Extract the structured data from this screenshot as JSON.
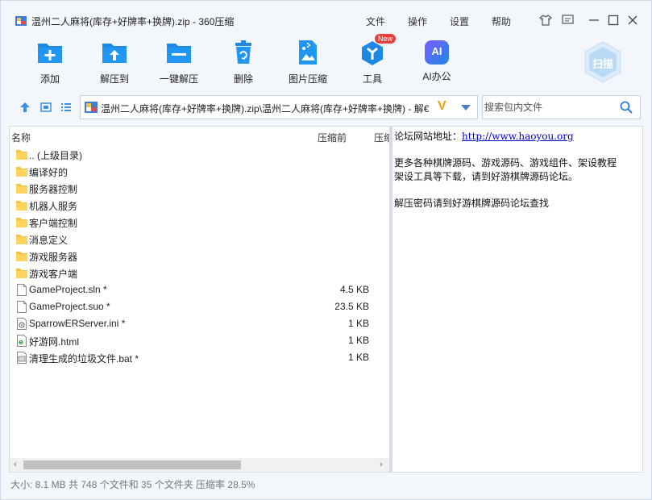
{
  "window": {
    "title": "温州二人麻将(库存+好牌率+换牌).zip - 360压缩",
    "menu": [
      "文件",
      "操作",
      "设置",
      "帮助"
    ]
  },
  "toolbar": {
    "items": [
      {
        "label": "添加",
        "icon": "add-icon"
      },
      {
        "label": "解压到",
        "icon": "extract-to-icon"
      },
      {
        "label": "一键解压",
        "icon": "one-click-extract-icon"
      },
      {
        "label": "删除",
        "icon": "delete-icon"
      },
      {
        "label": "图片压缩",
        "icon": "image-compress-icon"
      },
      {
        "label": "工具",
        "icon": "tools-icon",
        "badge": "New"
      },
      {
        "label": "AI办公",
        "icon": "ai-office-icon",
        "icon_text": "AI"
      }
    ],
    "scan_label": "扫描"
  },
  "address": {
    "path": "温州二人麻将(库存+好牌率+换牌).zip\\温州二人麻将(库存+好牌率+换牌) - 解€",
    "v_mark": "V"
  },
  "search": {
    "placeholder": "搜索包内文件"
  },
  "list": {
    "columns": [
      "名称",
      "压缩前",
      "压缩"
    ],
    "rows": [
      {
        "name": ".. (上级目录)",
        "size": "",
        "type": "folder"
      },
      {
        "name": "编译好的",
        "size": "",
        "type": "folder"
      },
      {
        "name": "服务器控制",
        "size": "",
        "type": "folder"
      },
      {
        "name": "机器人服务",
        "size": "",
        "type": "folder"
      },
      {
        "name": "客户端控制",
        "size": "",
        "type": "folder"
      },
      {
        "name": "消息定义",
        "size": "",
        "type": "folder"
      },
      {
        "name": "游戏服务器",
        "size": "",
        "type": "folder"
      },
      {
        "name": "游戏客户端",
        "size": "",
        "type": "folder"
      },
      {
        "name": "GameProject.sln *",
        "size": "4.5 KB",
        "type": "file"
      },
      {
        "name": "GameProject.suo *",
        "size": "23.5 KB",
        "type": "file"
      },
      {
        "name": "SparrowERServer.ini *",
        "size": "1 KB",
        "type": "ini"
      },
      {
        "name": "好游网.html",
        "size": "1 KB",
        "type": "html"
      },
      {
        "name": "清理生成的垃圾文件.bat *",
        "size": "1 KB",
        "type": "bat"
      }
    ]
  },
  "info": {
    "line1_prefix": "论坛网站地址：",
    "line1_link": "http://www.haoyou.org",
    "line2": "更多各种棋牌源码、游戏源码、游戏组件、架设教程",
    "line3": "架设工具等下载，请到好游棋牌源码论坛。",
    "line4": "解压密码请到好游棋牌源码论坛查找"
  },
  "status": "大小: 8.1 MB 共 748 个文件和 35 个文件夹 压缩率 28.5%",
  "colors": {
    "accent": "#2a8fe0",
    "badge": "#e8413c",
    "link": "#0000cc"
  }
}
